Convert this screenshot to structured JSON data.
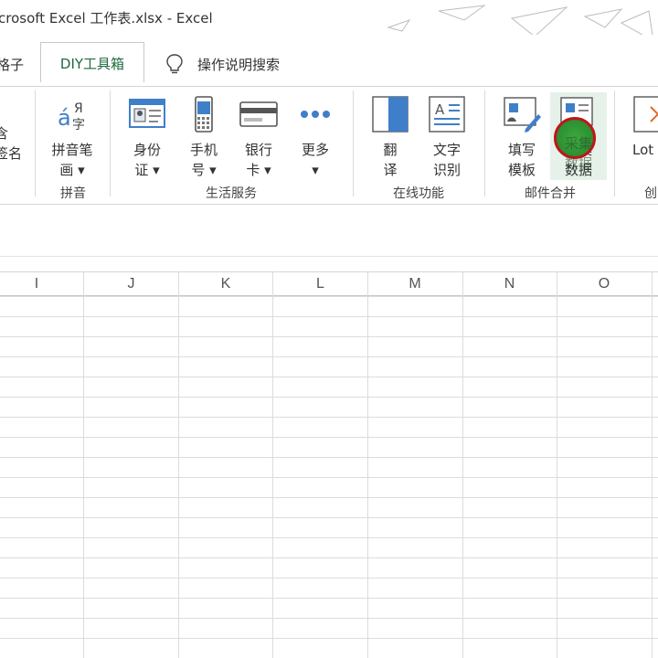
{
  "window": {
    "title": "crosoft Excel 工作表.xlsx  -  Excel"
  },
  "tabs": {
    "partial_left": "格子",
    "active": "DIY工具箱",
    "search": "操作说明搜索"
  },
  "ribbon": {
    "partial_left_lines": [
      "含",
      "签名"
    ],
    "groups": [
      {
        "label": "拼音",
        "buttons": [
          {
            "label": "拼音笔\n画 ▾",
            "icon": "pinyin-icon"
          }
        ]
      },
      {
        "label": "生活服务",
        "buttons": [
          {
            "label": "身份\n证 ▾",
            "icon": "id-card-icon"
          },
          {
            "label": "手机\n号 ▾",
            "icon": "phone-icon"
          },
          {
            "label": "银行\n卡 ▾",
            "icon": "bank-card-icon"
          },
          {
            "label": "更多\n▾",
            "icon": "more-icon"
          }
        ]
      },
      {
        "label": "在线功能",
        "buttons": [
          {
            "label": "翻\n译",
            "icon": "translate-icon"
          },
          {
            "label": "文字\n识别",
            "icon": "ocr-icon"
          }
        ]
      },
      {
        "label": "邮件合并",
        "buttons": [
          {
            "label": "填写\n模板",
            "icon": "fill-template-icon"
          },
          {
            "label": "采集\n数据",
            "icon": "collect-data-icon"
          }
        ]
      },
      {
        "label": "创",
        "buttons": [
          {
            "label": "Lot",
            "icon": "lottery-icon"
          }
        ]
      }
    ]
  },
  "columns": [
    "I",
    "J",
    "K",
    "L",
    "M",
    "N",
    "O"
  ],
  "colors": {
    "accent_green": "#1e6a3c",
    "highlight_red": "#c0151a",
    "highlight_green": "#2d8f32",
    "icon_blue": "#3f7fc9"
  }
}
